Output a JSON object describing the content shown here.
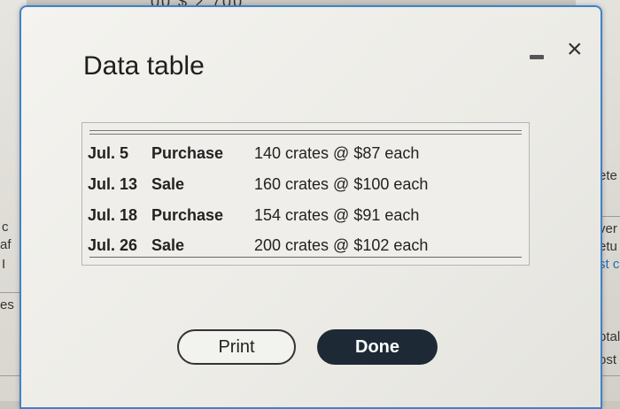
{
  "background": {
    "top_fragment": "00 $   2,700",
    "right_fragments": [
      "ete",
      "ver",
      "etu",
      "st c",
      "otal",
      "ost"
    ],
    "left_fragments": [
      "c",
      "af",
      "I",
      "es"
    ]
  },
  "dialog": {
    "title": "Data table",
    "minimize_icon": "minimize-icon",
    "close_icon": "×"
  },
  "table": {
    "rows": [
      {
        "date": "Jul. 5",
        "type": "Purchase",
        "detail": "140 crates @ $87 each"
      },
      {
        "date": "Jul. 13",
        "type": "Sale",
        "detail": "160 crates @ $100 each"
      },
      {
        "date": "Jul. 18",
        "type": "Purchase",
        "detail": "154 crates @ $91 each"
      },
      {
        "date": "Jul. 26",
        "type": "Sale",
        "detail": "200 crates @ $102 each"
      }
    ]
  },
  "buttons": {
    "print": "Print",
    "done": "Done"
  },
  "colors": {
    "dialog_border": "#3f82c8",
    "done_button": "#1d2a36"
  }
}
